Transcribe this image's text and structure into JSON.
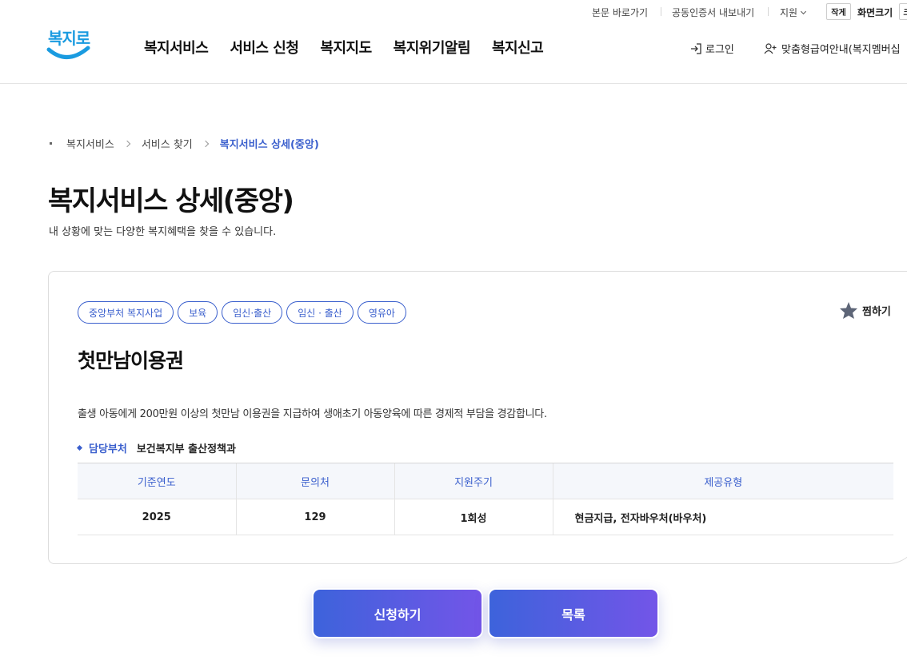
{
  "utility": {
    "skip_link": "본문 바로가기",
    "cert_export": "공동인증서 내보내기",
    "support": "지원",
    "font_small": "작게",
    "screen_size": "화면크기",
    "font_cut": "크"
  },
  "logo": {
    "text": "복지로"
  },
  "nav": {
    "items": [
      "복지서비스",
      "서비스 신청",
      "복지지도",
      "복지위기알림",
      "복지신고"
    ]
  },
  "header_actions": {
    "login": "로그인",
    "member": "맞춤형급여안내(복지멤버십"
  },
  "breadcrumb": {
    "items": [
      "복지서비스",
      "서비스 찾기"
    ],
    "current": "복지서비스 상세(중앙)"
  },
  "page": {
    "title": "복지서비스 상세(중앙)",
    "description": "내 상황에 맞는 다양한 복지혜택을 찾을 수 있습니다."
  },
  "service": {
    "tags": [
      "중앙부처 복지사업",
      "보육",
      "임신·출산",
      "임신 · 출산",
      "영유아"
    ],
    "favorite_label": "찜하기",
    "title": "첫만남이용권",
    "description": "출생 아동에게 200만원 이상의 첫만남 이용권을 지급하여 생애초기 아동양육에 따른 경제적 부담을 경감합니다.",
    "department_label": "담당부처",
    "department_value": "보건복지부 출산정책과",
    "table": {
      "headers": [
        "기준연도",
        "문의처",
        "지원주기",
        "제공유형"
      ],
      "row": [
        "2025",
        "129",
        "1회성",
        "현금지급, 전자바우처(바우처)"
      ]
    }
  },
  "buttons": {
    "apply": "신청하기",
    "list": "목록"
  },
  "colors": {
    "accent": "#3a5fcd",
    "logo": "#1a9be0",
    "button_start": "#3d63db",
    "button_end": "#7355e8"
  }
}
